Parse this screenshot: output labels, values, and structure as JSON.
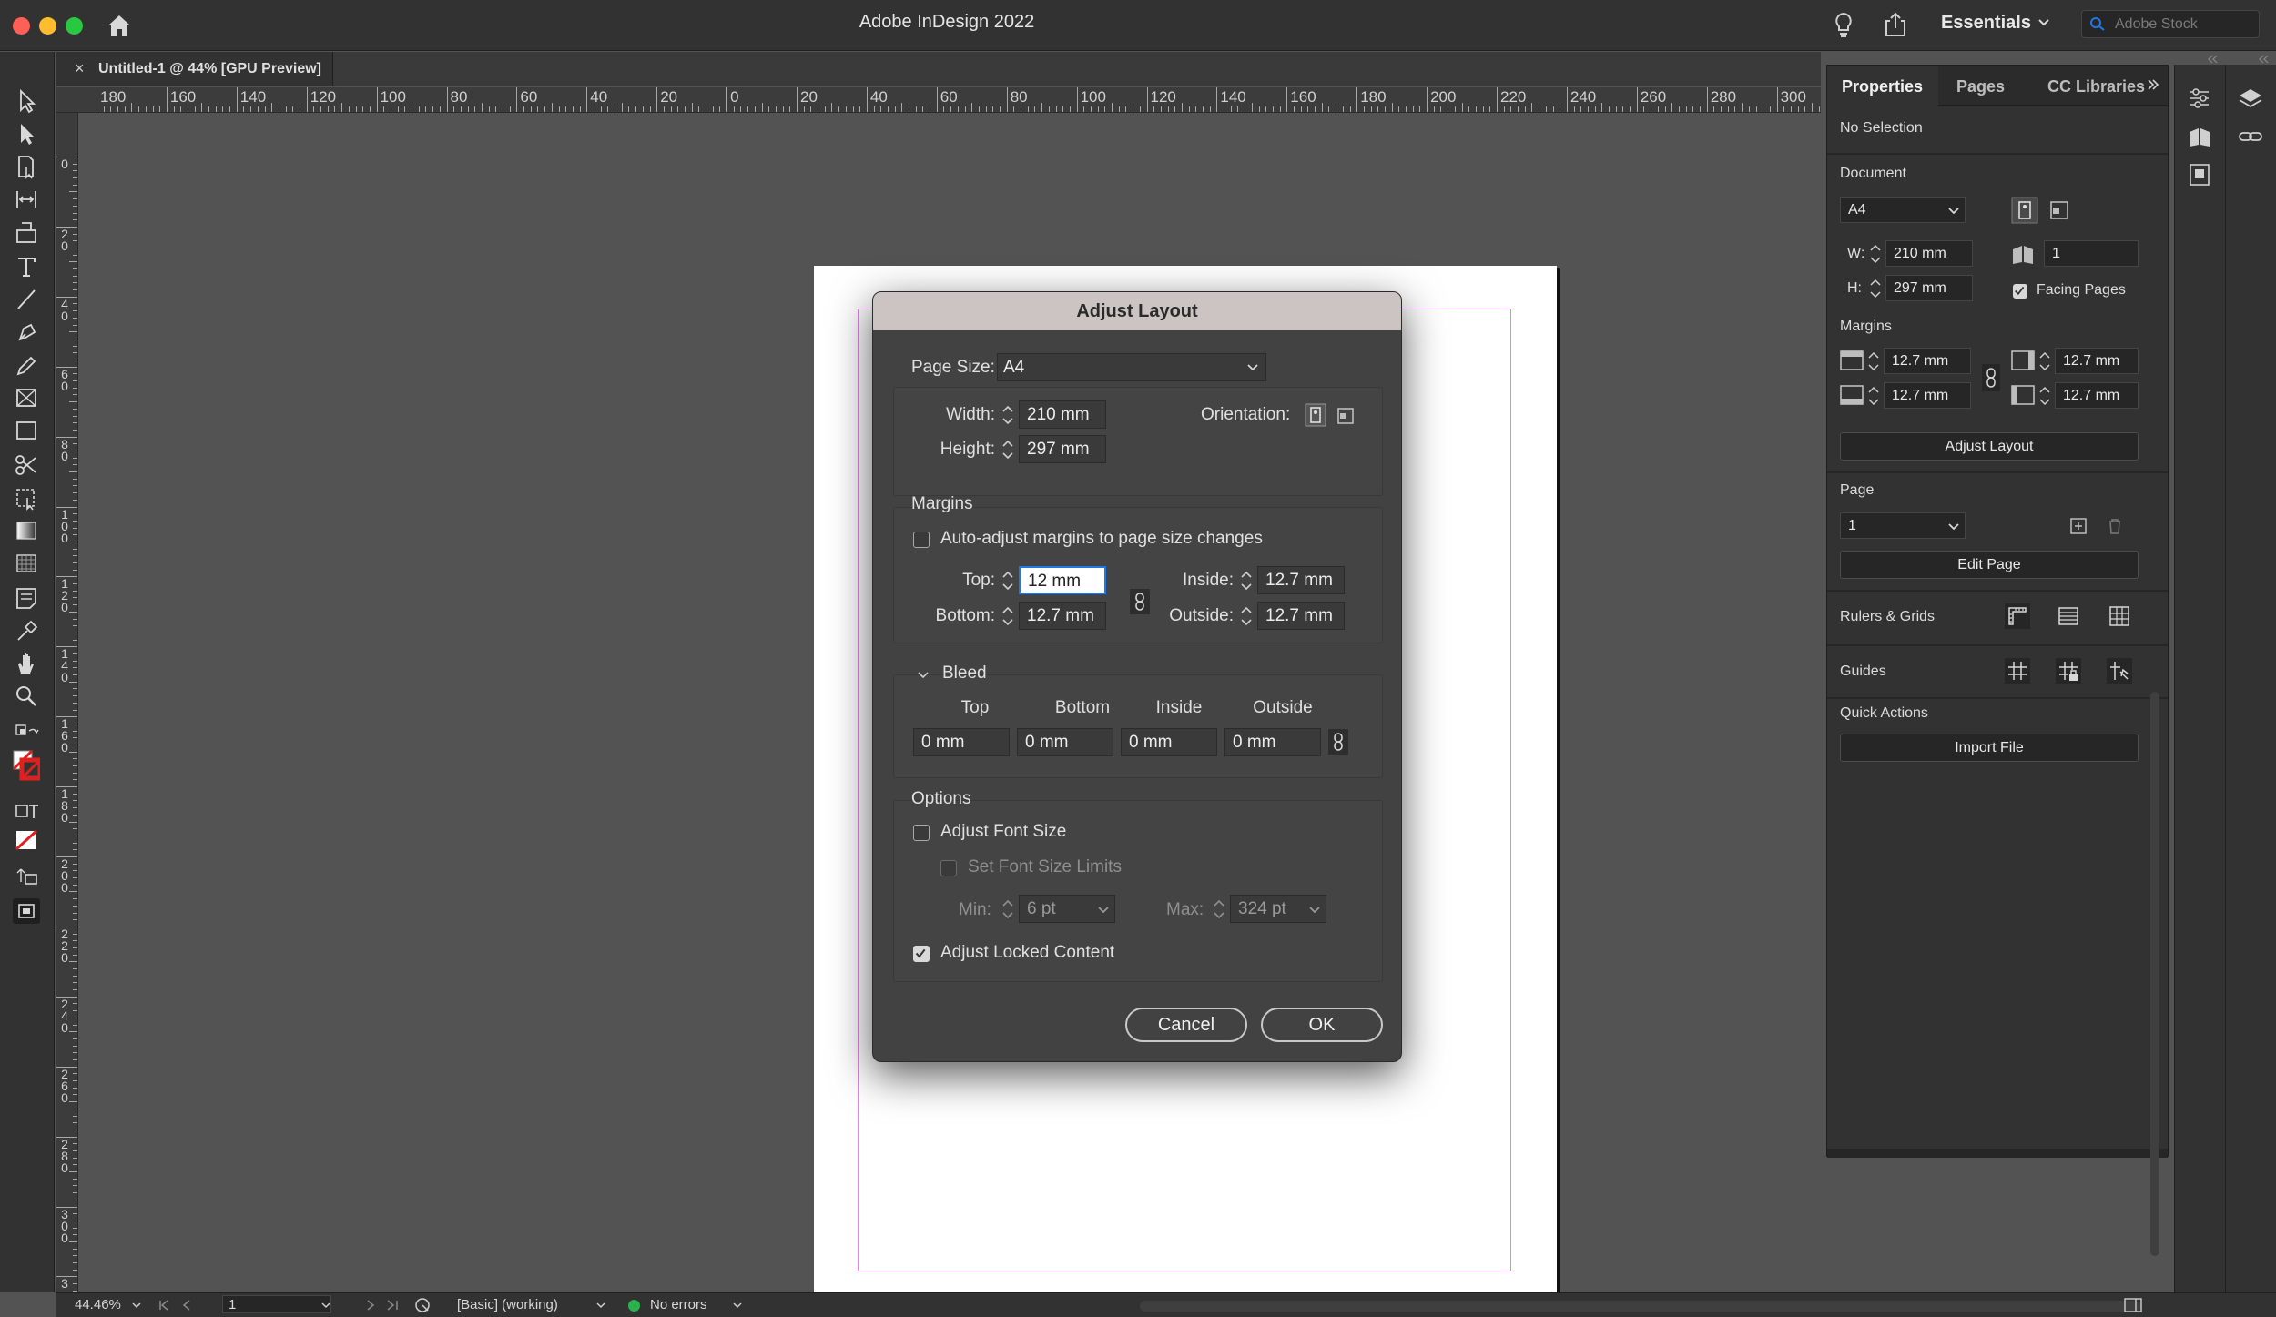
{
  "app": {
    "title": "Adobe InDesign 2022",
    "workspace": "Essentials",
    "stock_placeholder": "Adobe Stock",
    "document_tab": "Untitled-1 @ 44% [GPU Preview]",
    "tab_close": "×"
  },
  "ruler": {
    "horizontal": [
      "180",
      "160",
      "140",
      "120",
      "100",
      "80",
      "60",
      "40",
      "20",
      "0",
      "20",
      "40",
      "60",
      "80",
      "100",
      "120",
      "140",
      "160",
      "180",
      "200",
      "220",
      "240",
      "260",
      "280",
      "300"
    ],
    "vertical": [
      "0",
      "20",
      "40",
      "60",
      "80",
      "100",
      "120",
      "140",
      "160",
      "180",
      "200",
      "220",
      "240",
      "260",
      "280",
      "300",
      "3"
    ]
  },
  "dialog": {
    "title": "Adjust Layout",
    "page_size_label": "Page Size:",
    "page_size": "A4",
    "width_label": "Width:",
    "width": "210 mm",
    "height_label": "Height:",
    "height": "297 mm",
    "orientation_label": "Orientation:",
    "margins_heading": "Margins",
    "auto_adjust": "Auto-adjust margins to page size changes",
    "auto_adjust_checked": false,
    "top_label": "Top:",
    "top": "12 mm",
    "bottom_label": "Bottom:",
    "bottom": "12.7 mm",
    "inside_label": "Inside:",
    "inside": "12.7 mm",
    "outside_label": "Outside:",
    "outside": "12.7 mm",
    "bleed_heading": "Bleed",
    "bleed_cols": [
      "Top",
      "Bottom",
      "Inside",
      "Outside"
    ],
    "bleed_values": [
      "0 mm",
      "0 mm",
      "0 mm",
      "0 mm"
    ],
    "options_heading": "Options",
    "adjust_font_size": "Adjust Font Size",
    "adjust_font_size_checked": false,
    "set_font_limits": "Set Font Size Limits",
    "set_font_limits_checked": false,
    "min_label": "Min:",
    "min_value": "6 pt",
    "max_label": "Max:",
    "max_value": "324 pt",
    "adjust_locked": "Adjust Locked Content",
    "adjust_locked_checked": true,
    "cancel": "Cancel",
    "ok": "OK"
  },
  "panel": {
    "tabs": [
      "Properties",
      "Pages",
      "CC Libraries"
    ],
    "selection": "No Selection",
    "document_heading": "Document",
    "doc_preset": "A4",
    "w_label": "W:",
    "w_value": "210 mm",
    "h_label": "H:",
    "h_value": "297 mm",
    "pages_count": "1",
    "facing_pages": "Facing Pages",
    "facing_checked": true,
    "margins_heading": "Margins",
    "m_top": "12.7 mm",
    "m_bottom": "12.7 mm",
    "m_inside": "12.7 mm",
    "m_outside": "12.7 mm",
    "adjust_layout_btn": "Adjust Layout",
    "page_heading": "Page",
    "page_value": "1",
    "edit_page_btn": "Edit Page",
    "rulers_grids": "Rulers & Grids",
    "guides": "Guides",
    "quick_actions": "Quick Actions",
    "import_file_btn": "Import File"
  },
  "status": {
    "zoom": "44.46%",
    "page": "1",
    "style": "[Basic] (working)",
    "preflight": "No errors",
    "preflight_color": "#2bb24c"
  },
  "colors": {
    "margin_guide": "#e285e6",
    "focus": "#1e78e6"
  }
}
